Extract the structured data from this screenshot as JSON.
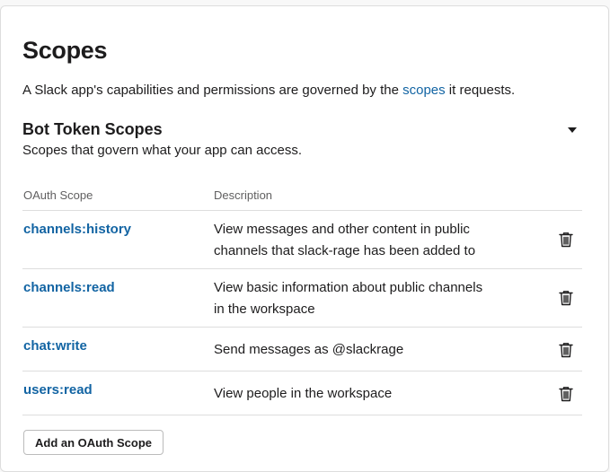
{
  "page": {
    "title": "Scopes",
    "description_before": "A Slack app's capabilities and permissions are governed by the ",
    "description_link": "scopes",
    "description_after": " it requests."
  },
  "bot_section": {
    "title": "Bot Token Scopes",
    "subtitle": "Scopes that govern what your app can access.",
    "columns": {
      "scope": "OAuth Scope",
      "description": "Description"
    },
    "rows": [
      {
        "scope": "channels:history",
        "line1": "View messages and other content in public",
        "line2": "channels that slack-rage has been added to"
      },
      {
        "scope": "channels:read",
        "line1": "View basic information about public channels",
        "line2": "in the workspace"
      },
      {
        "scope": "chat:write",
        "line1": "Send messages as @slackrage",
        "line2": ""
      },
      {
        "scope": "users:read",
        "line1": "View people in the workspace",
        "line2": ""
      }
    ],
    "add_button": "Add an OAuth Scope"
  },
  "colors": {
    "link": "#1264a3",
    "text": "#1d1c1d",
    "muted": "#616061",
    "border": "#dddddd"
  }
}
